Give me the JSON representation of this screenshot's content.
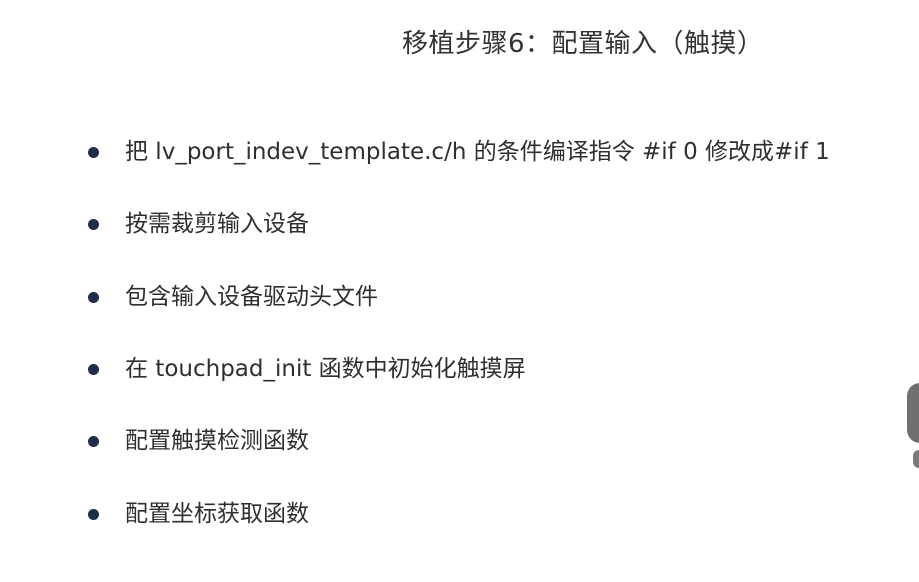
{
  "slide": {
    "title": "移植步骤6：配置输入（触摸）",
    "bullets": [
      "把 lv_port_indev_template.c/h 的条件编译指令 #if 0 修改成#if 1",
      "按需裁剪输入设备",
      "包含输入设备驱动头文件",
      "在 touchpad_init 函数中初始化触摸屏",
      "配置触摸检测函数",
      "配置坐标获取函数"
    ]
  }
}
